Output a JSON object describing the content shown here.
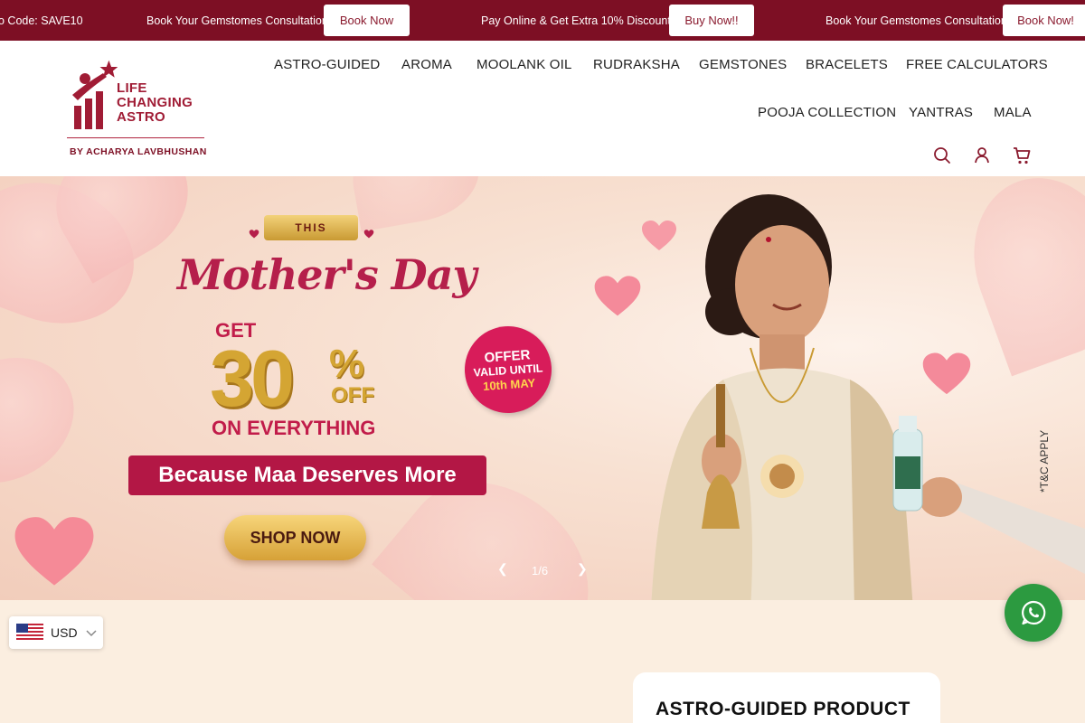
{
  "announcement": {
    "items": [
      {
        "text": "o Code: SAVE10"
      },
      {
        "text": "Book Your Gemstomes Consultation",
        "button": "Book Now"
      },
      {
        "text": "Pay Online & Get Extra 10% Discount!",
        "button": "Buy Now!!"
      },
      {
        "text": "Book Your Gemstomes Consultation",
        "button": "Book Now!"
      }
    ]
  },
  "logo": {
    "line1": "LIFE",
    "line2": "CHANGING",
    "line3": "ASTRO",
    "subtitle": "BY ACHARYA LAVBHUSHAN"
  },
  "nav": {
    "row1": [
      "ASTRO-GUIDED",
      "AROMA",
      "MOOLANK OIL",
      "RUDRAKSHA",
      "GEMSTONES",
      "BRACELETS",
      "FREE CALCULATORS"
    ],
    "row2": [
      "POOJA COLLECTION",
      "YANTRAS",
      "MALA"
    ]
  },
  "hero": {
    "this_label": "THIS",
    "title": "Mother's Day",
    "get": "GET",
    "discount": "30",
    "percent": "%",
    "off": "OFF",
    "on_everything": "ON EVERYTHING",
    "tagline": "Because Maa Deserves More",
    "cta": "SHOP NOW",
    "badge": {
      "line1": "OFFER",
      "line2": "VALID UNTIL",
      "line3": "10th MAY"
    },
    "tnc": "*T&C APPLY",
    "slide_counter": "1/6"
  },
  "currency": {
    "code": "USD"
  },
  "product_section": {
    "title": "ASTRO-GUIDED PRODUCT"
  },
  "colors": {
    "brand": "#7d0f24",
    "accent": "#b31745",
    "gold": "#d4a533",
    "whatsapp": "#2c9a40"
  },
  "icons": [
    "search-icon",
    "user-icon",
    "cart-icon",
    "whatsapp-icon",
    "us-flag-icon",
    "chevron-down-icon",
    "chevron-left-icon",
    "chevron-right-icon"
  ]
}
